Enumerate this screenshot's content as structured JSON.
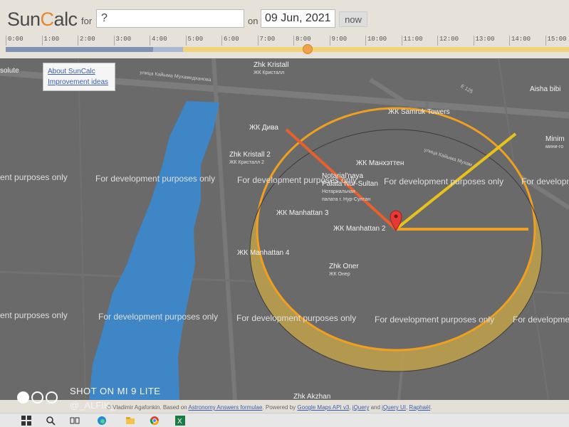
{
  "app": {
    "logo_prefix": "Sun",
    "logo_accent": "C",
    "logo_suffix": "alc"
  },
  "header": {
    "for_label": "for",
    "location_value": "?",
    "on_label": "on",
    "date_value": "09 Jun, 2021",
    "now_label": "now"
  },
  "timeline": {
    "ticks": [
      "0:00",
      "1:00",
      "2:00",
      "3:00",
      "4:00",
      "5:00",
      "6:00",
      "7:00",
      "8:00",
      "9:00",
      "10:00",
      "11:00",
      "12:00",
      "13:00",
      "14:00",
      "15:00"
    ],
    "current_hour": 8.4
  },
  "info_links": {
    "about": "About SunCalc",
    "improvements": "Improvement ideas"
  },
  "map": {
    "watermarks": [
      "For development purposes only",
      "For development purposes only",
      "For development purposes only",
      "For development",
      "ent purposes only",
      "ent purposes only",
      "For development purposes only",
      "For development purposes only",
      "For development purposes only",
      "For development purposes only",
      "For development"
    ],
    "places": {
      "kristall": "Zhk Kristall",
      "kristall_ru": "ЖК Кристалл",
      "samruk": "ЖК Samruk Towers",
      "diva": "ЖК Дива",
      "kristall2": "Zhk Kristall 2",
      "kristall2_ru": "ЖК Кристалл 2",
      "manhattan_ru": "ЖК Манхэттен",
      "notarial": "Notarial'naya",
      "notarial2": "Palata Nur-Sultan",
      "notarial_ru": "Нотариальная",
      "notarial_ru2": "палата г. Нур-Султан",
      "manhattan3": "ЖК Manhattan 3",
      "manhattan2": "ЖК Manhattan 2",
      "manhattan4": "ЖК Manhattan 4",
      "oner": "Zhk Oner",
      "oner_ru": "ЖК Онер",
      "aisha": "Aisha bibi",
      "minimi": "Minim",
      "minimi_ru": "мини-го",
      "solute": "solute",
      "akzhan": "Zhk Akzhan"
    },
    "streets": {
      "street1": "улица Кайыма Мухамедханова",
      "street2": "улица Кайыма Мухам",
      "street3": "Е 125"
    }
  },
  "overlay": {
    "camera_title": "SHOT ON MI 9 LITE",
    "camera_handle": "@_ALFIK_"
  },
  "footer": {
    "text_a": "© Vladimir Agafonkin. Based on",
    "link1": "Astronomy Answers formulae",
    "text_b": ". Powered by",
    "link2": "Google Maps API v3",
    "link3": "jQuery",
    "text_c": "and",
    "link4": "jQuery UI",
    "link5": "Raphaël"
  },
  "colors": {
    "accent": "#e3862c",
    "sun_path": "#f0c419",
    "sunrise_line": "#e8602c",
    "sun_line": "#e8c21a",
    "river": "#3f86c6"
  }
}
